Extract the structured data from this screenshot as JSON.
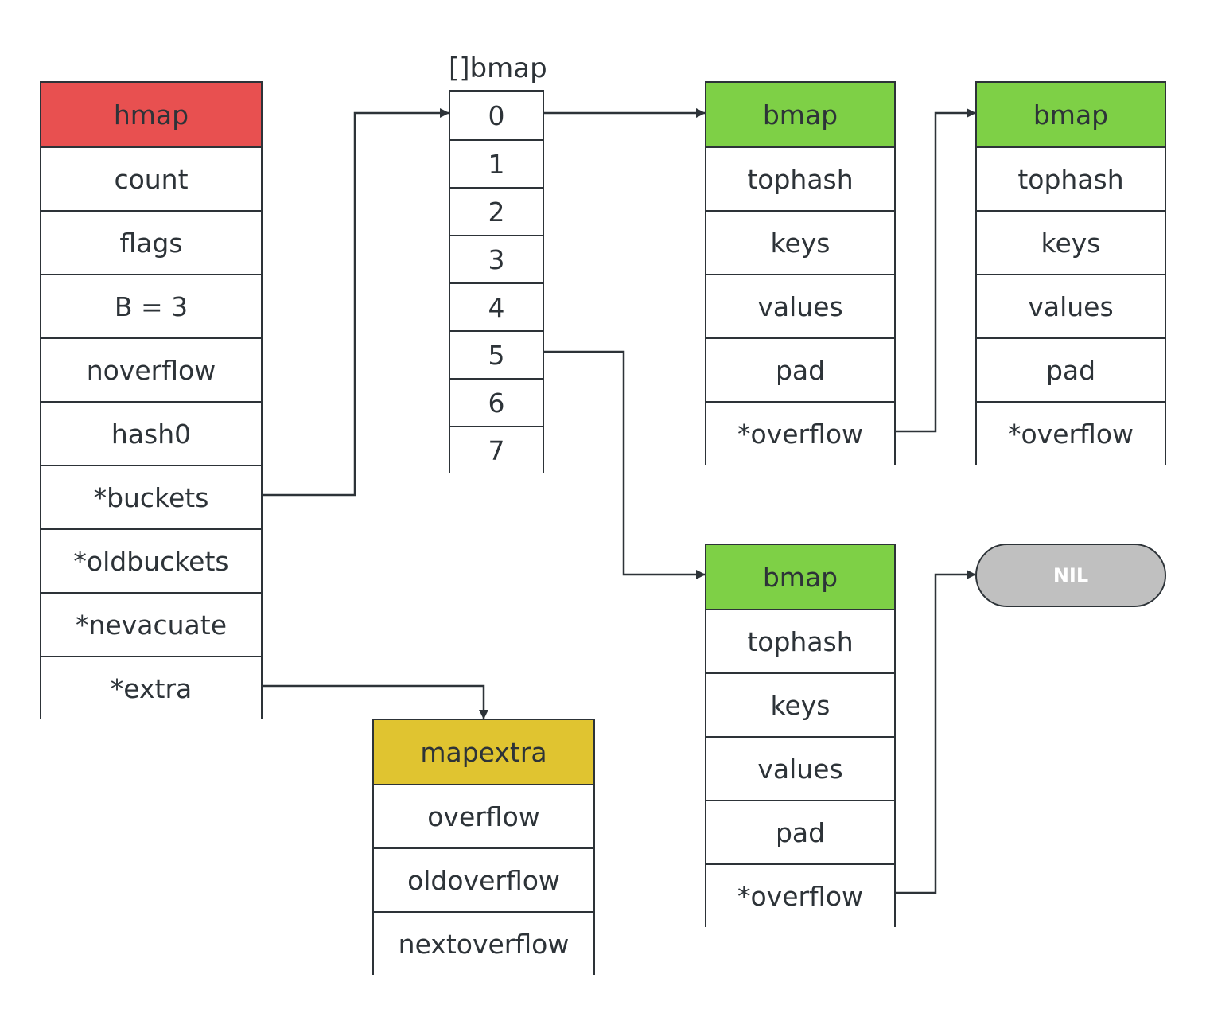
{
  "colors": {
    "hmap": "#e85050",
    "bmap": "#7ed046",
    "mapextra": "#e0c430",
    "nil": "#c0c0c0",
    "line": "#2d3338"
  },
  "array_label": "[]bmap",
  "tables": [
    {
      "id": "hmap",
      "header": "hmap",
      "color_key": "hmap",
      "fields": [
        "count",
        "flags",
        "B = 3",
        "noverflow",
        "hash0",
        "*buckets",
        "*oldbuckets",
        "*nevacuate",
        "*extra"
      ]
    },
    {
      "id": "buckets-array",
      "header": null,
      "fields": [
        "0",
        "1",
        "2",
        "3",
        "4",
        "5",
        "6",
        "7"
      ]
    },
    {
      "id": "bmap-1",
      "header": "bmap",
      "color_key": "bmap",
      "fields": [
        "tophash",
        "keys",
        "values",
        "pad",
        "*overflow"
      ]
    },
    {
      "id": "bmap-2",
      "header": "bmap",
      "color_key": "bmap",
      "fields": [
        "tophash",
        "keys",
        "values",
        "pad",
        "*overflow"
      ]
    },
    {
      "id": "bmap-3",
      "header": "bmap",
      "color_key": "bmap",
      "fields": [
        "tophash",
        "keys",
        "values",
        "pad",
        "*overflow"
      ]
    },
    {
      "id": "mapextra",
      "header": "mapextra",
      "color_key": "mapextra",
      "fields": [
        "overflow",
        "oldoverflow",
        "nextoverflow"
      ]
    }
  ],
  "nil_label": "NIL"
}
